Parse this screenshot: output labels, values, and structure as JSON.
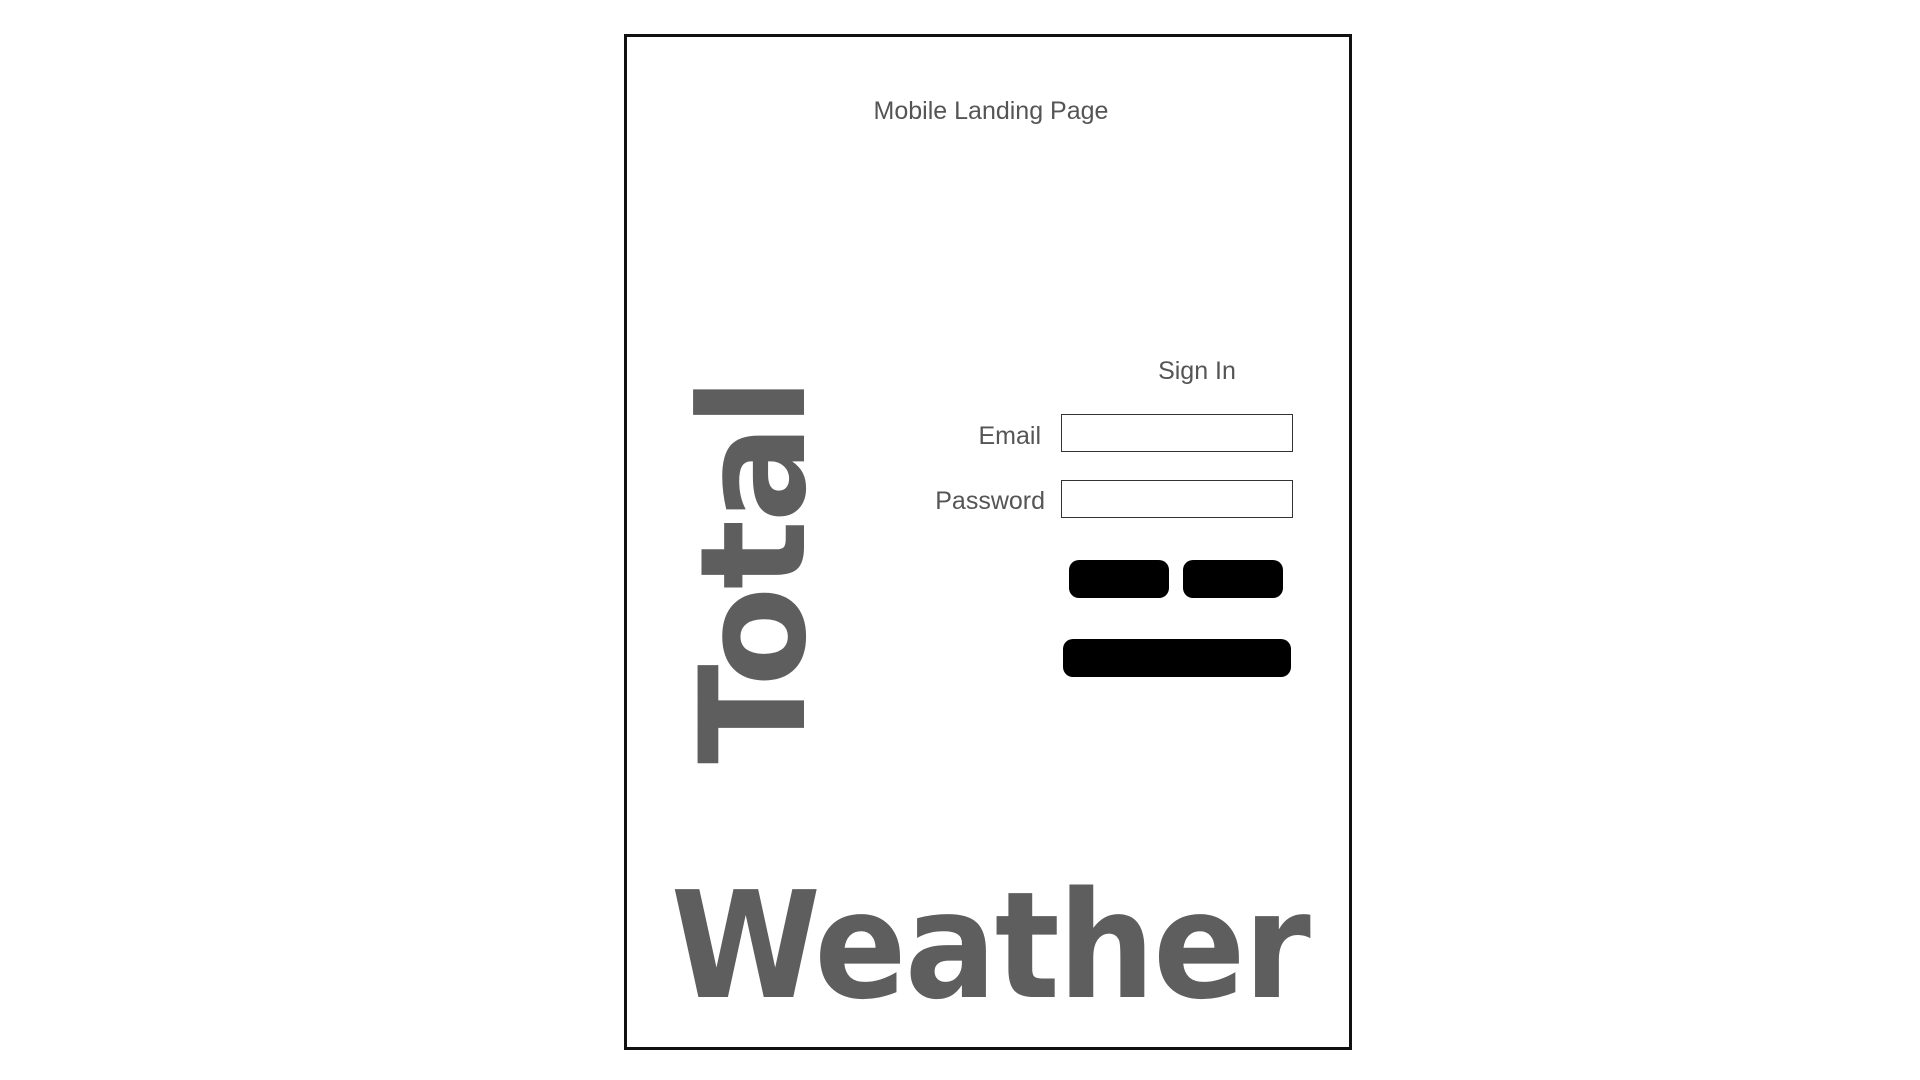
{
  "page": {
    "title": "Mobile Landing Page"
  },
  "brand": {
    "word_vertical": "Total",
    "word_horizontal": "Weather"
  },
  "signin": {
    "title": "Sign In",
    "email_label": "Email",
    "email_value": "",
    "password_label": "Password",
    "password_value": "",
    "buttons": [
      {
        "label": ""
      },
      {
        "label": ""
      },
      {
        "label": ""
      }
    ]
  },
  "colors": {
    "text": "#555555",
    "brand": "#5e5e5e",
    "button": "#000000",
    "frame_border": "#111111"
  }
}
